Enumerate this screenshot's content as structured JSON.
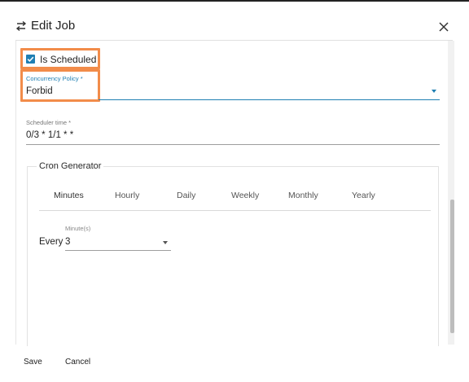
{
  "dialog": {
    "title": "Edit Job",
    "title_icon": "swap-icon",
    "close_icon": "close-icon"
  },
  "form": {
    "is_scheduled": {
      "label": "Is Scheduled",
      "checked": true
    },
    "concurrency_policy": {
      "label": "Concurrency Policy *",
      "value": "Forbid"
    },
    "scheduler_time": {
      "label": "Scheduler time *",
      "value": "0/3 * 1/1 * *"
    }
  },
  "cron_generator": {
    "legend": "Cron Generator",
    "tabs": [
      "Minutes",
      "Hourly",
      "Daily",
      "Weekly",
      "Monthly",
      "Yearly"
    ],
    "active_tab": "Minutes",
    "every_label": "Every",
    "minutes_field": {
      "label": "Minute(s)",
      "value": "3"
    }
  },
  "footer": {
    "save_label": "Save",
    "cancel_label": "Cancel"
  },
  "colors": {
    "accent": "#1f7fb3",
    "highlight": "#f28c4a",
    "focus_underline": "#1f7fb3"
  }
}
